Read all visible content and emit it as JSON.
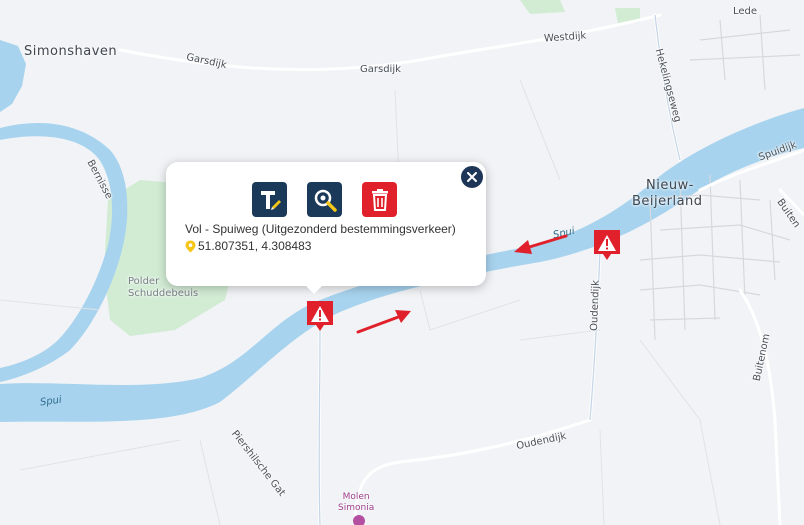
{
  "map": {
    "places": {
      "simonshaven": "Simonshaven",
      "nieuw_beijerland_1": "Nieuw-",
      "nieuw_beijerland_2": "Beijerland",
      "polder_1": "Polder",
      "polder_2": "Schuddebeuis"
    },
    "roads": {
      "gersdijk_1": "Garsdijk",
      "gersdijk_2": "Garsdijk",
      "westdijk": "Westdijk",
      "lede": "Lede",
      "hekelingseweg": "Hekelingseweg",
      "oudendijk_v": "Oudendijk",
      "oudendijk_h": "Oudendijk",
      "buitenom": "Buitenom",
      "buiten_r": "Buiten",
      "spuidijk": "Spuidijk",
      "bernisse": "Bernisse",
      "piershilsche_gat": "Piershilsche Gat"
    },
    "water": {
      "spui_left": "Spui",
      "spui_right": "Spui"
    },
    "poi": {
      "molen_1": "Molen",
      "molen_2": "Simonia"
    },
    "colors": {
      "water": "#a7d3ee",
      "land": "#f1f3f6",
      "park": "#d2ecd4",
      "warning": "#e0212b",
      "arrow": "#e0212b"
    }
  },
  "popup": {
    "title": "Vol - Spuiweg (Uitgezonderd bestemmingsverkeer)",
    "coordinates": "51.807351, 4.308483",
    "tools": [
      {
        "icon": "edit-text-icon",
        "color": "#1b3a59"
      },
      {
        "icon": "zoom-icon",
        "color": "#1b3a59"
      },
      {
        "icon": "trash-icon",
        "color": "#e0212b"
      }
    ],
    "close_icon": "close-icon",
    "pin_icon": "location-pin-icon"
  }
}
